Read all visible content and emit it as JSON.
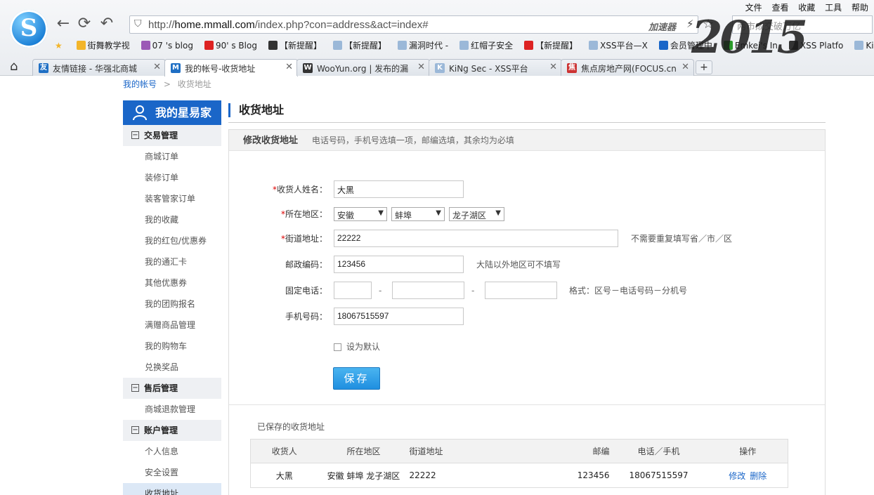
{
  "browser": {
    "url_prefix": "http://",
    "url_host": "home.mmall.com",
    "url_rest": "/index.php?con=address&act=index#",
    "accelerator": "加速器",
    "search_placeholder": "两市成交破万亿",
    "menu": [
      "文件",
      "查看",
      "收藏",
      "工具",
      "帮助"
    ],
    "bookmarks": [
      {
        "label": "街舞教学视",
        "color": "#f3b52a"
      },
      {
        "label": "07 's blog",
        "color": "#9b59b6"
      },
      {
        "label": "90' s Blog",
        "color": "#dd2222"
      },
      {
        "label": "【新提醒】",
        "color": "#333333"
      },
      {
        "label": "【新提醒】",
        "color": "#9bb8d8"
      },
      {
        "label": "漏洞时代 -",
        "color": "#9bb8d8"
      },
      {
        "label": "红帽子安全",
        "color": "#9bb8d8"
      },
      {
        "label": "【新提醒】",
        "color": "#dd2222"
      },
      {
        "label": "XSS平台—X",
        "color": "#9bb8d8"
      },
      {
        "label": "会员管理中",
        "color": "#1a66c8"
      },
      {
        "label": "Emkei's In",
        "color": "#2a9a2a"
      },
      {
        "label": "XSS Platfo",
        "color": "#333333"
      },
      {
        "label": "KiNg S",
        "color": "#9bb8d8"
      }
    ],
    "tabs": [
      {
        "label": "友情链接 - 华强北商城",
        "fav": "友"
      },
      {
        "label": "我的帐号-收货地址",
        "fav": "M"
      },
      {
        "label": "WooYun.org | 发布的漏",
        "fav": "W"
      },
      {
        "label": "KiNg Sec - XSS平台",
        "fav": "K"
      },
      {
        "label": "焦点房地产网(FOCUS.cn",
        "fav": "焦"
      }
    ]
  },
  "breadcrumb": {
    "root": "我的帐号",
    "sep": ">",
    "current": "收货地址"
  },
  "sidebar": {
    "title": "我的星易家",
    "groups": [
      {
        "title": "交易管理",
        "items": [
          "商城订单",
          "装修订单",
          "装客管家订单",
          "我的收藏",
          "我的红包/优惠券",
          "我的通汇卡",
          "其他优惠券",
          "我的团购报名",
          "满赠商品管理",
          "我的购物车",
          "兑换奖品"
        ]
      },
      {
        "title": "售后管理",
        "items": [
          "商城退款管理"
        ]
      },
      {
        "title": "账户管理",
        "items": [
          "个人信息",
          "安全设置",
          "收货地址"
        ]
      }
    ]
  },
  "main": {
    "title": "收货地址",
    "panel_title": "修改收货地址",
    "panel_desc": "电话号码，手机号选填一项，邮编选填，其余均为必填",
    "form": {
      "name_label": "收货人姓名：",
      "name_value": "大黑",
      "region_label": "所在地区：",
      "province": "安徽",
      "city": "蚌埠",
      "district": "龙子湖区",
      "street_label": "街道地址：",
      "street_value": "22222",
      "street_hint": "不需要重复填写省／市／区",
      "zip_label": "邮政编码：",
      "zip_value": "123456",
      "zip_hint": "大陆以外地区可不填写",
      "phone_label": "固定电话：",
      "phone_dash": "-",
      "phone_hint": "格式：区号－电话号码－分机号",
      "mobile_label": "手机号码：",
      "mobile_value": "18067515597",
      "default_label": "设为默认",
      "save_label": "保存"
    },
    "saved": {
      "title": "已保存的收货地址",
      "columns": [
        "收货人",
        "所在地区",
        "街道地址",
        "邮编",
        "电话／手机",
        "操作"
      ],
      "rows": [
        {
          "name": "大黑",
          "region": "安徽  蚌埠  龙子湖区",
          "street": "22222",
          "zip": "123456",
          "phone": "18067515597",
          "edit": "修改",
          "delete": "删除"
        }
      ]
    }
  },
  "colors": {
    "accent": "#1a66c8",
    "required": "#dd0000"
  }
}
